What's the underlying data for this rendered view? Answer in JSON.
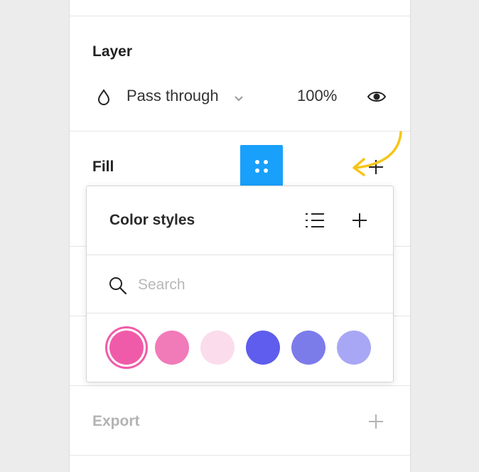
{
  "layer": {
    "title": "Layer",
    "blend_mode": "Pass through",
    "opacity": "100%"
  },
  "fill": {
    "title": "Fill"
  },
  "color_styles": {
    "title": "Color styles",
    "search": {
      "placeholder": "Search",
      "value": ""
    },
    "swatches": [
      {
        "color": "#f05ba9",
        "selected": true
      },
      {
        "color": "#f17ab8"
      },
      {
        "color": "#fbdcec"
      },
      {
        "color": "#5e5ded"
      },
      {
        "color": "#7c7bea"
      },
      {
        "color": "#a8a7f5"
      }
    ]
  },
  "export": {
    "title": "Export"
  },
  "colors": {
    "accent": "#18a0fb",
    "annotation_arrow": "#f5c518"
  },
  "icons": [
    "blend-drop-icon",
    "chevron-down-icon",
    "eye-icon",
    "style-grid-icon",
    "plus-icon",
    "list-icon",
    "search-icon"
  ]
}
